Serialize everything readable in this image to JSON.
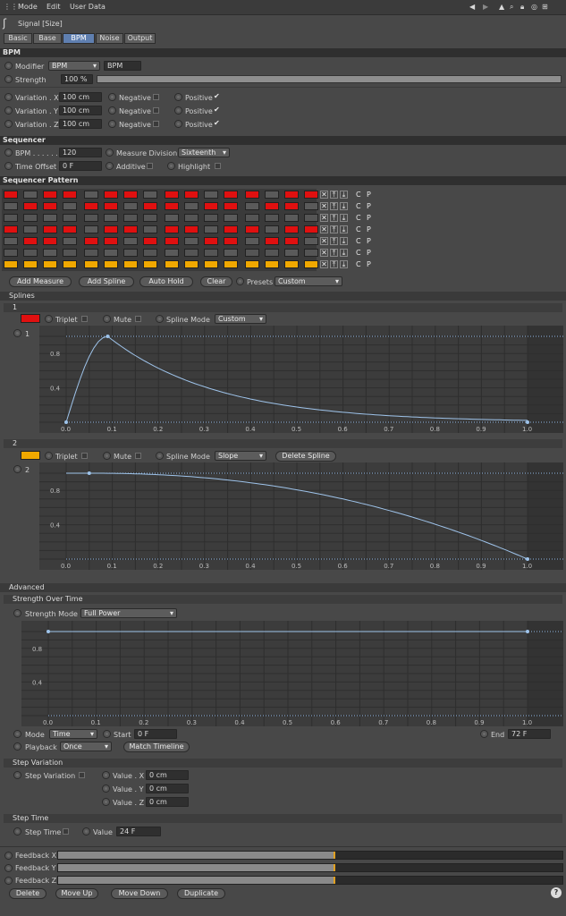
{
  "menu": {
    "mode": "Mode",
    "edit": "Edit",
    "user_data": "User Data"
  },
  "title": "Signal [Size]",
  "tabs": [
    "Basic",
    "Base",
    "BPM",
    "Noise",
    "Output"
  ],
  "active_tab": "BPM",
  "bpm": {
    "header": "BPM",
    "modifier_label": "Modifier",
    "modifier_value": "BPM",
    "modifier_name": "BPM",
    "strength_label": "Strength",
    "strength_value": "100 %",
    "rows": [
      {
        "label": "Variation . X",
        "value": "100 cm",
        "neg": "Negative",
        "pos": "Positive"
      },
      {
        "label": "Variation . Y",
        "value": "100 cm",
        "neg": "Negative",
        "pos": "Positive"
      },
      {
        "label": "Variation . Z",
        "value": "100 cm",
        "neg": "Negative",
        "pos": "Positive"
      }
    ]
  },
  "sequencer": {
    "header": "Sequencer",
    "bpm_label": "BPM . . . . . .",
    "bpm_value": "120",
    "measure_label": "Measure Division",
    "measure_value": "Sixteenth",
    "offset_label": "Time Offset",
    "offset_value": "0 F",
    "additive": "Additive",
    "highlight": "Highlight"
  },
  "pattern": {
    "header": "Sequencer Pattern",
    "c": "C",
    "p": "P"
  },
  "buttons": {
    "add_measure": "Add Measure",
    "add_spline": "Add Spline",
    "auto_hold": "Auto Hold",
    "clear": "Clear",
    "presets": "Presets",
    "presets_value": "Custom"
  },
  "splines": {
    "header": "Splines",
    "items": [
      {
        "id": "1",
        "color": "#e01010",
        "triplet": "Triplet",
        "mute": "Mute",
        "mode_label": "Spline Mode",
        "mode": "Custom",
        "num": "1"
      },
      {
        "id": "2",
        "color": "#f0a800",
        "triplet": "Triplet",
        "mute": "Mute",
        "mode_label": "Spline Mode",
        "mode": "Slope",
        "delete": "Delete Spline",
        "num": "2"
      }
    ]
  },
  "axis": {
    "y": [
      "0.8",
      "0.4"
    ],
    "x": [
      "0.0",
      "0.1",
      "0.2",
      "0.3",
      "0.4",
      "0.5",
      "0.6",
      "0.7",
      "0.8",
      "0.9",
      "1.0"
    ]
  },
  "advanced": {
    "header": "Advanced",
    "sot": "Strength Over Time",
    "strength_mode_label": "Strength Mode",
    "strength_mode": "Full Power",
    "mode_label": "Mode",
    "mode_value": "Time",
    "start_label": "Start",
    "start_value": "0 F",
    "end_label": "End",
    "end_value": "72 F",
    "playback_label": "Playback",
    "playback_value": "Once",
    "match": "Match Timeline"
  },
  "step_variation": {
    "header": "Step Variation",
    "label": "Step Variation",
    "x": "Value . X",
    "y": "Value . Y",
    "z": "Value . Z",
    "xv": "0 cm",
    "yv": "0 cm",
    "zv": "0 cm"
  },
  "step_time": {
    "header": "Step Time",
    "label": "Step Time",
    "value_label": "Value",
    "value": "24 F"
  },
  "feedback": [
    {
      "label": "Feedback X",
      "level": 0.55
    },
    {
      "label": "Feedback Y",
      "level": 0.55
    },
    {
      "label": "Feedback Z",
      "level": 0.55
    }
  ],
  "bottom": {
    "delete": "Delete",
    "move_up": "Move Up",
    "move_down": "Move Down",
    "duplicate": "Duplicate"
  }
}
